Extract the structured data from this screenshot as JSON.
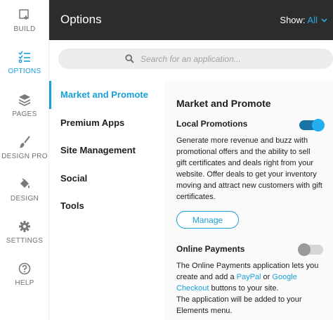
{
  "rail": {
    "items": [
      {
        "label": "BUILD",
        "icon": "build-icon"
      },
      {
        "label": "OPTIONS",
        "icon": "options-icon"
      },
      {
        "label": "PAGES",
        "icon": "pages-icon"
      },
      {
        "label": "DESIGN PRO",
        "icon": "brush-icon"
      },
      {
        "label": "DESIGN",
        "icon": "paint-bucket-icon"
      },
      {
        "label": "SETTINGS",
        "icon": "gear-icon"
      },
      {
        "label": "HELP",
        "icon": "question-icon"
      }
    ],
    "active_index": 1
  },
  "header": {
    "title": "Options",
    "show_label": "Show:",
    "show_value": "All"
  },
  "search": {
    "placeholder": "Search for an application..."
  },
  "categories": {
    "items": [
      "Market and Promote",
      "Premium Apps",
      "Site Management",
      "Social",
      "Tools"
    ],
    "active_index": 0
  },
  "detail": {
    "title": "Market and Promote",
    "apps": [
      {
        "name": "Local Promotions",
        "enabled": true,
        "description_lines": [
          "Generate more revenue and buzz with",
          "promotional offers and the ability to sell",
          "gift certificates and deals right from your",
          "website. Offer deals to get your inventory",
          "moving and attract new customers with gift",
          "certificates."
        ],
        "button_label": "Manage"
      },
      {
        "name": "Online Payments",
        "enabled": false,
        "desc_line1": "The Online Payments application lets you",
        "desc_line2_a": "create and add a ",
        "desc_link1": "PayPal",
        "desc_line2_b": " or ",
        "desc_link2": "Google",
        "desc_link2b": "Checkout",
        "desc_line3_b": " buttons to your site.",
        "desc_line4": "The application will be added to your",
        "desc_line5": "Elements menu."
      }
    ]
  },
  "colors": {
    "accent": "#1a9fd9",
    "header_bg": "#2c2c2c"
  }
}
